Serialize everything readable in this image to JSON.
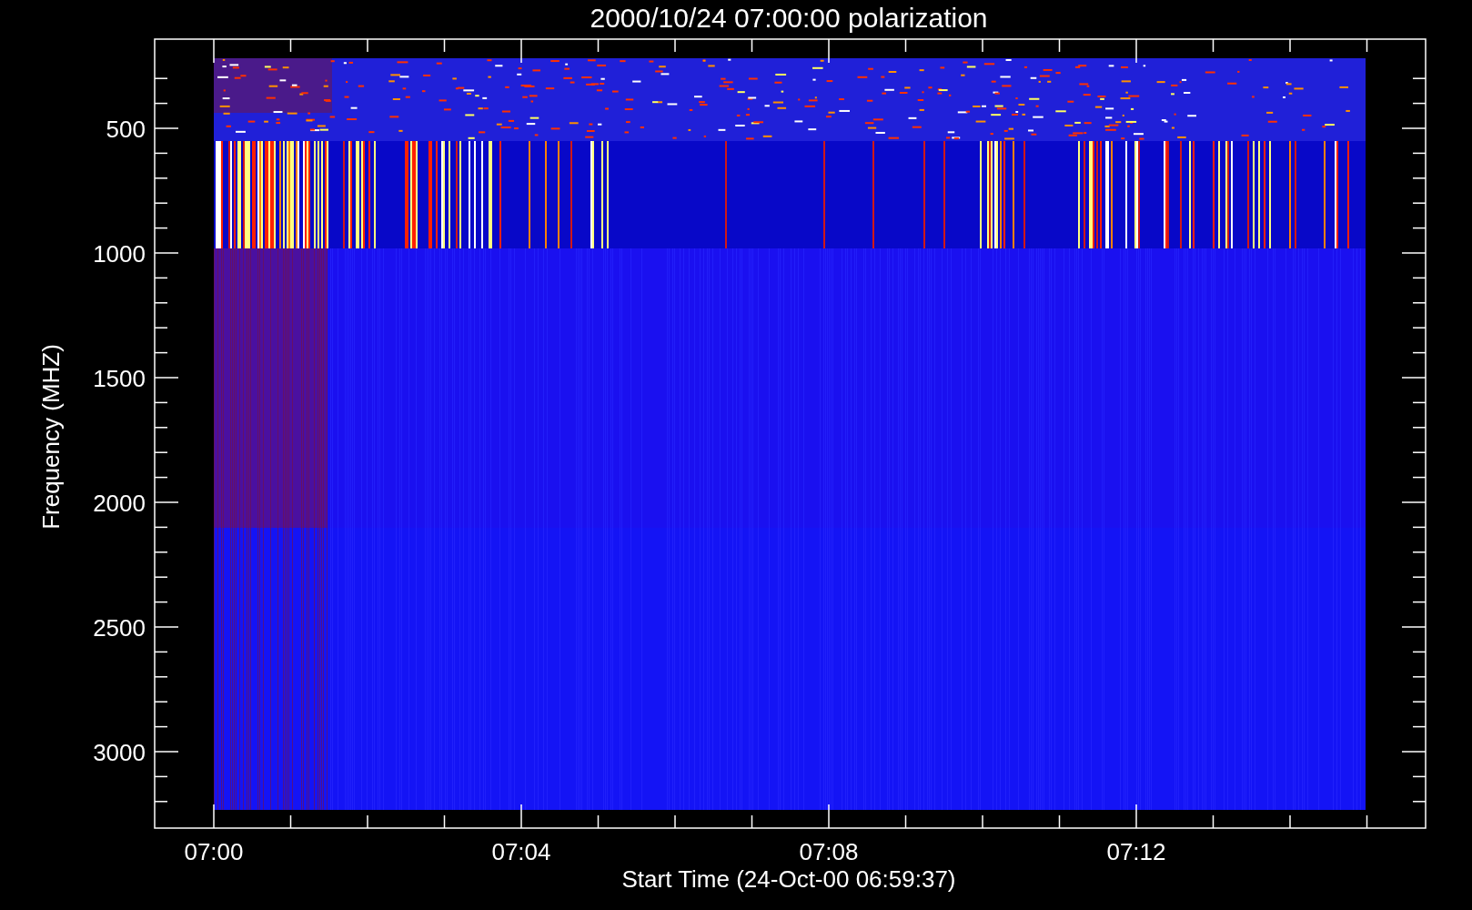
{
  "plot": {
    "title": "2000/10/24 07:00:00 polarization",
    "ylabel": "Frequency (MHZ)",
    "xlabel": "Start Time (24-Oct-00 06:59:37)",
    "yticks": [
      "500",
      "1000",
      "1500",
      "2000",
      "2500",
      "3000"
    ],
    "xticks": [
      "07:00",
      "07:04",
      "07:08",
      "07:12"
    ]
  }
}
